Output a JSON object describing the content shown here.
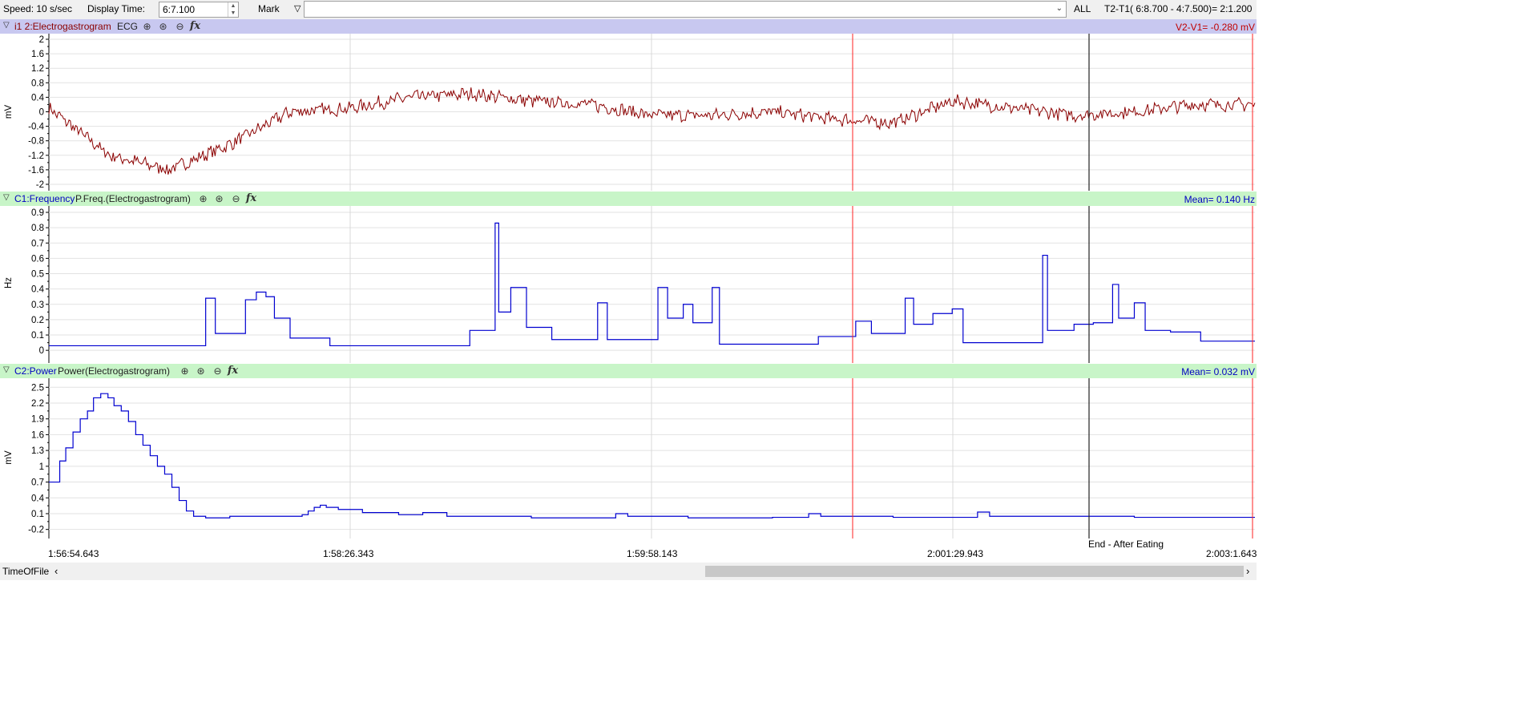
{
  "toolbar": {
    "speed": "Speed: 10 s/sec",
    "display_time_label": "Display Time:",
    "display_time_value": "6:7.100",
    "mark_label": "Mark",
    "all_label": "ALL",
    "t2t1": "T2-T1( 6:8.700 -  4:7.500)=  2:1.200"
  },
  "channels": [
    {
      "name": "i1 2:Electrogastrogram",
      "sub": "ECG",
      "value": "V2-V1= -0.280 mV",
      "unit": "mV",
      "ticks": [
        "2",
        "1.6",
        "1.2",
        "0.8",
        "0.4",
        "0",
        "-0.4",
        "-0.8",
        "-1.2",
        "-1.6",
        "-2"
      ],
      "tick_values": [
        2,
        1.6,
        1.2,
        0.8,
        0.4,
        0,
        -0.4,
        -0.8,
        -1.2,
        -1.6,
        -2
      ],
      "ylim": [
        -2,
        2
      ],
      "color": "#8b0000",
      "header_bg": "#c8c8f0",
      "name_color": "#8b0000",
      "value_color": "#c00000"
    },
    {
      "name": "C1:Frequency",
      "sub": "P.Freq.(Electrogastrogram)",
      "value": "Mean= 0.140 Hz",
      "unit": "Hz",
      "ticks": [
        "0.9",
        "0.8",
        "0.7",
        "0.6",
        "0.5",
        "0.4",
        "0.3",
        "0.2",
        "0.1",
        "0"
      ],
      "tick_values": [
        0.9,
        0.8,
        0.7,
        0.6,
        0.5,
        0.4,
        0.3,
        0.2,
        0.1,
        0
      ],
      "ylim": [
        -0.02,
        0.9
      ],
      "color": "#0000d0",
      "header_bg": "#c8f5c8",
      "name_color": "#0000c0",
      "value_color": "#0000c0"
    },
    {
      "name": "C2:Power",
      "sub": "Power(Electrogastrogram)",
      "value": "Mean= 0.032 mV",
      "unit": "mV",
      "ticks": [
        "2.5",
        "2.2",
        "1.9",
        "1.6",
        "1.3",
        "1",
        "0.7",
        "0.4",
        "0.1",
        "-0.2"
      ],
      "tick_values": [
        2.5,
        2.2,
        1.9,
        1.6,
        1.3,
        1,
        0.7,
        0.4,
        0.1,
        -0.2
      ],
      "ylim": [
        -0.22,
        2.55
      ],
      "color": "#0000d0",
      "header_bg": "#c8f5c8",
      "name_color": "#0000c0",
      "value_color": "#0000c0"
    }
  ],
  "time_axis": {
    "labels": [
      "1:56:54.643",
      "1:58:26.343",
      "1:59:58.143",
      "2:001:29.943",
      "2:003:1.643"
    ],
    "marker_label": "End - After Eating"
  },
  "status": {
    "label": "TimeOfFile"
  },
  "chart_data": [
    {
      "type": "line",
      "title": "i1 2:Electrogastrogram ECG",
      "ylabel": "mV",
      "ylim": [
        -2,
        2
      ],
      "x_start": "1:56:54.643",
      "x_end": "2:003:1.643",
      "x": [
        0,
        0.05,
        0.1,
        0.15,
        0.2,
        0.25,
        0.3,
        0.35,
        0.4,
        0.45,
        0.5,
        0.55,
        0.6,
        0.65,
        0.7,
        0.75,
        0.8,
        0.85,
        0.9,
        0.95,
        1
      ],
      "values": [
        0.1,
        -1.2,
        -1.6,
        -0.9,
        0.0,
        0.1,
        0.4,
        0.5,
        0.3,
        0.2,
        -0.1,
        -0.1,
        0.0,
        -0.2,
        -0.3,
        0.3,
        0.1,
        -0.1,
        0.0,
        0.2,
        0.2
      ]
    },
    {
      "type": "line",
      "title": "C1:Frequency P.Freq.(Electrogastrogram)",
      "ylabel": "Hz",
      "ylim": [
        0,
        0.9
      ],
      "series": [
        {
          "name": "C1:Frequency",
          "step": true,
          "points": [
            [
              0,
              0.03
            ],
            [
              0.13,
              0.34
            ],
            [
              0.138,
              0.11
            ],
            [
              0.163,
              0.33
            ],
            [
              0.172,
              0.38
            ],
            [
              0.18,
              0.35
            ],
            [
              0.187,
              0.21
            ],
            [
              0.2,
              0.08
            ],
            [
              0.233,
              0.03
            ],
            [
              0.349,
              0.13
            ],
            [
              0.37,
              0.83
            ],
            [
              0.373,
              0.25
            ],
            [
              0.383,
              0.41
            ],
            [
              0.396,
              0.15
            ],
            [
              0.417,
              0.07
            ],
            [
              0.455,
              0.31
            ],
            [
              0.463,
              0.07
            ],
            [
              0.505,
              0.41
            ],
            [
              0.513,
              0.21
            ],
            [
              0.526,
              0.3
            ],
            [
              0.534,
              0.18
            ],
            [
              0.55,
              0.41
            ],
            [
              0.556,
              0.04
            ],
            [
              0.638,
              0.09
            ],
            [
              0.669,
              0.19
            ],
            [
              0.682,
              0.11
            ],
            [
              0.71,
              0.34
            ],
            [
              0.717,
              0.17
            ],
            [
              0.733,
              0.24
            ],
            [
              0.749,
              0.27
            ],
            [
              0.758,
              0.05
            ],
            [
              0.824,
              0.62
            ],
            [
              0.828,
              0.13
            ],
            [
              0.85,
              0.17
            ],
            [
              0.866,
              0.18
            ],
            [
              0.882,
              0.43
            ],
            [
              0.887,
              0.21
            ],
            [
              0.9,
              0.31
            ],
            [
              0.909,
              0.13
            ],
            [
              0.93,
              0.12
            ],
            [
              0.955,
              0.06
            ],
            [
              1,
              0.06
            ]
          ]
        }
      ]
    },
    {
      "type": "line",
      "title": "C2:Power Power(Electrogastrogram)",
      "ylabel": "mV",
      "ylim": [
        -0.2,
        2.5
      ],
      "series": [
        {
          "name": "C2:Power",
          "step": true,
          "points": [
            [
              0,
              0.7
            ],
            [
              0.009,
              1.1
            ],
            [
              0.014,
              1.35
            ],
            [
              0.02,
              1.65
            ],
            [
              0.026,
              1.9
            ],
            [
              0.032,
              2.05
            ],
            [
              0.037,
              2.3
            ],
            [
              0.043,
              2.38
            ],
            [
              0.049,
              2.3
            ],
            [
              0.054,
              2.15
            ],
            [
              0.06,
              2.05
            ],
            [
              0.066,
              1.85
            ],
            [
              0.072,
              1.6
            ],
            [
              0.078,
              1.4
            ],
            [
              0.084,
              1.2
            ],
            [
              0.09,
              1.0
            ],
            [
              0.096,
              0.85
            ],
            [
              0.102,
              0.6
            ],
            [
              0.108,
              0.35
            ],
            [
              0.114,
              0.15
            ],
            [
              0.12,
              0.05
            ],
            [
              0.13,
              0.02
            ],
            [
              0.15,
              0.05
            ],
            [
              0.2,
              0.05
            ],
            [
              0.21,
              0.08
            ],
            [
              0.215,
              0.15
            ],
            [
              0.22,
              0.22
            ],
            [
              0.225,
              0.26
            ],
            [
              0.23,
              0.22
            ],
            [
              0.24,
              0.18
            ],
            [
              0.26,
              0.12
            ],
            [
              0.29,
              0.08
            ],
            [
              0.31,
              0.12
            ],
            [
              0.33,
              0.05
            ],
            [
              0.4,
              0.02
            ],
            [
              0.47,
              0.1
            ],
            [
              0.48,
              0.05
            ],
            [
              0.53,
              0.02
            ],
            [
              0.6,
              0.03
            ],
            [
              0.63,
              0.1
            ],
            [
              0.64,
              0.05
            ],
            [
              0.7,
              0.03
            ],
            [
              0.77,
              0.13
            ],
            [
              0.78,
              0.05
            ],
            [
              0.9,
              0.03
            ],
            [
              1,
              0.03
            ]
          ]
        }
      ]
    }
  ]
}
